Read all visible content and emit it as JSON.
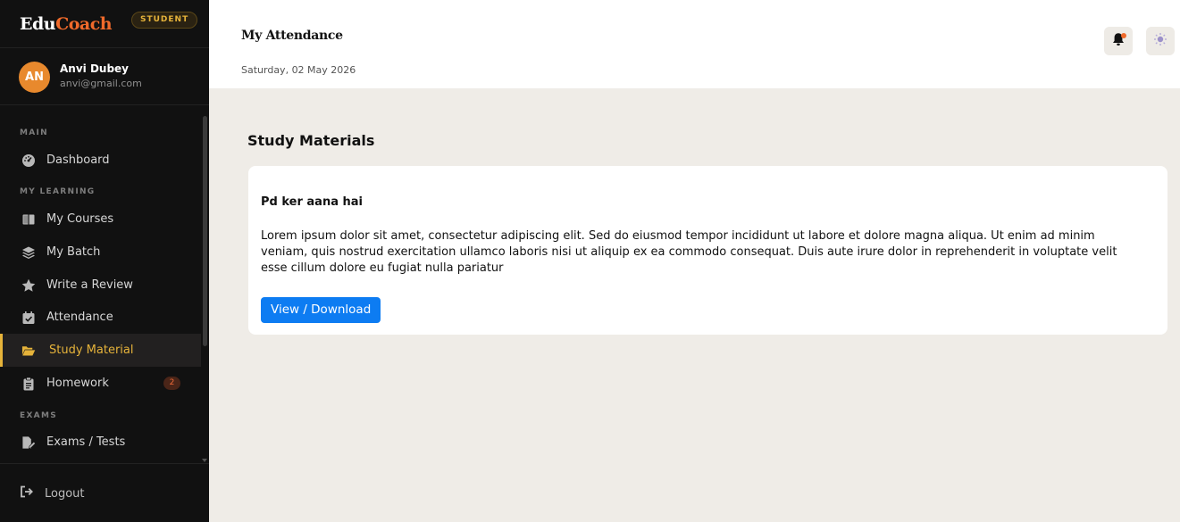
{
  "brand": {
    "part1": "Edu",
    "part2": "Coach",
    "role_badge": "STUDENT"
  },
  "user": {
    "initials": "AN",
    "name": "Anvi Dubey",
    "email": "anvi@gmail.com"
  },
  "nav": {
    "sections": {
      "main": "MAIN",
      "learning": "MY LEARNING",
      "exams": "EXAMS"
    },
    "items": [
      {
        "label": "Dashboard",
        "icon": "gauge-icon"
      },
      {
        "label": "My Courses",
        "icon": "book-icon"
      },
      {
        "label": "My Batch",
        "icon": "layers-icon"
      },
      {
        "label": "Write a Review",
        "icon": "star-icon"
      },
      {
        "label": "Attendance",
        "icon": "calendar-check-icon"
      },
      {
        "label": "Study Material",
        "icon": "folder-open-icon",
        "active": true
      },
      {
        "label": "Homework",
        "icon": "clipboard-icon",
        "badge": "2"
      },
      {
        "label": "Exams / Tests",
        "icon": "file-edit-icon"
      }
    ],
    "logout": "Logout"
  },
  "header": {
    "title": "My Attendance",
    "date": "Saturday, 02 May 2026"
  },
  "main": {
    "section_title": "Study Materials",
    "material": {
      "title": "Pd ker aana hai",
      "description": "Lorem ipsum dolor sit amet, consectetur adipiscing elit. Sed do eiusmod tempor incididunt ut labore et dolore magna aliqua. Ut enim ad minim veniam, quis nostrud exercitation ullamco laboris nisi ut aliquip ex ea commodo consequat. Duis aute irure dolor in reprehenderit in voluptate velit esse cillum dolore eu fugiat nulla pariatur",
      "button": "View / Download"
    }
  },
  "colors": {
    "accent": "#e6b33a",
    "brand_orange": "#f06a2b",
    "primary_button": "#0d7cf2",
    "sidebar_bg": "#111111",
    "page_bg": "#efece7"
  }
}
